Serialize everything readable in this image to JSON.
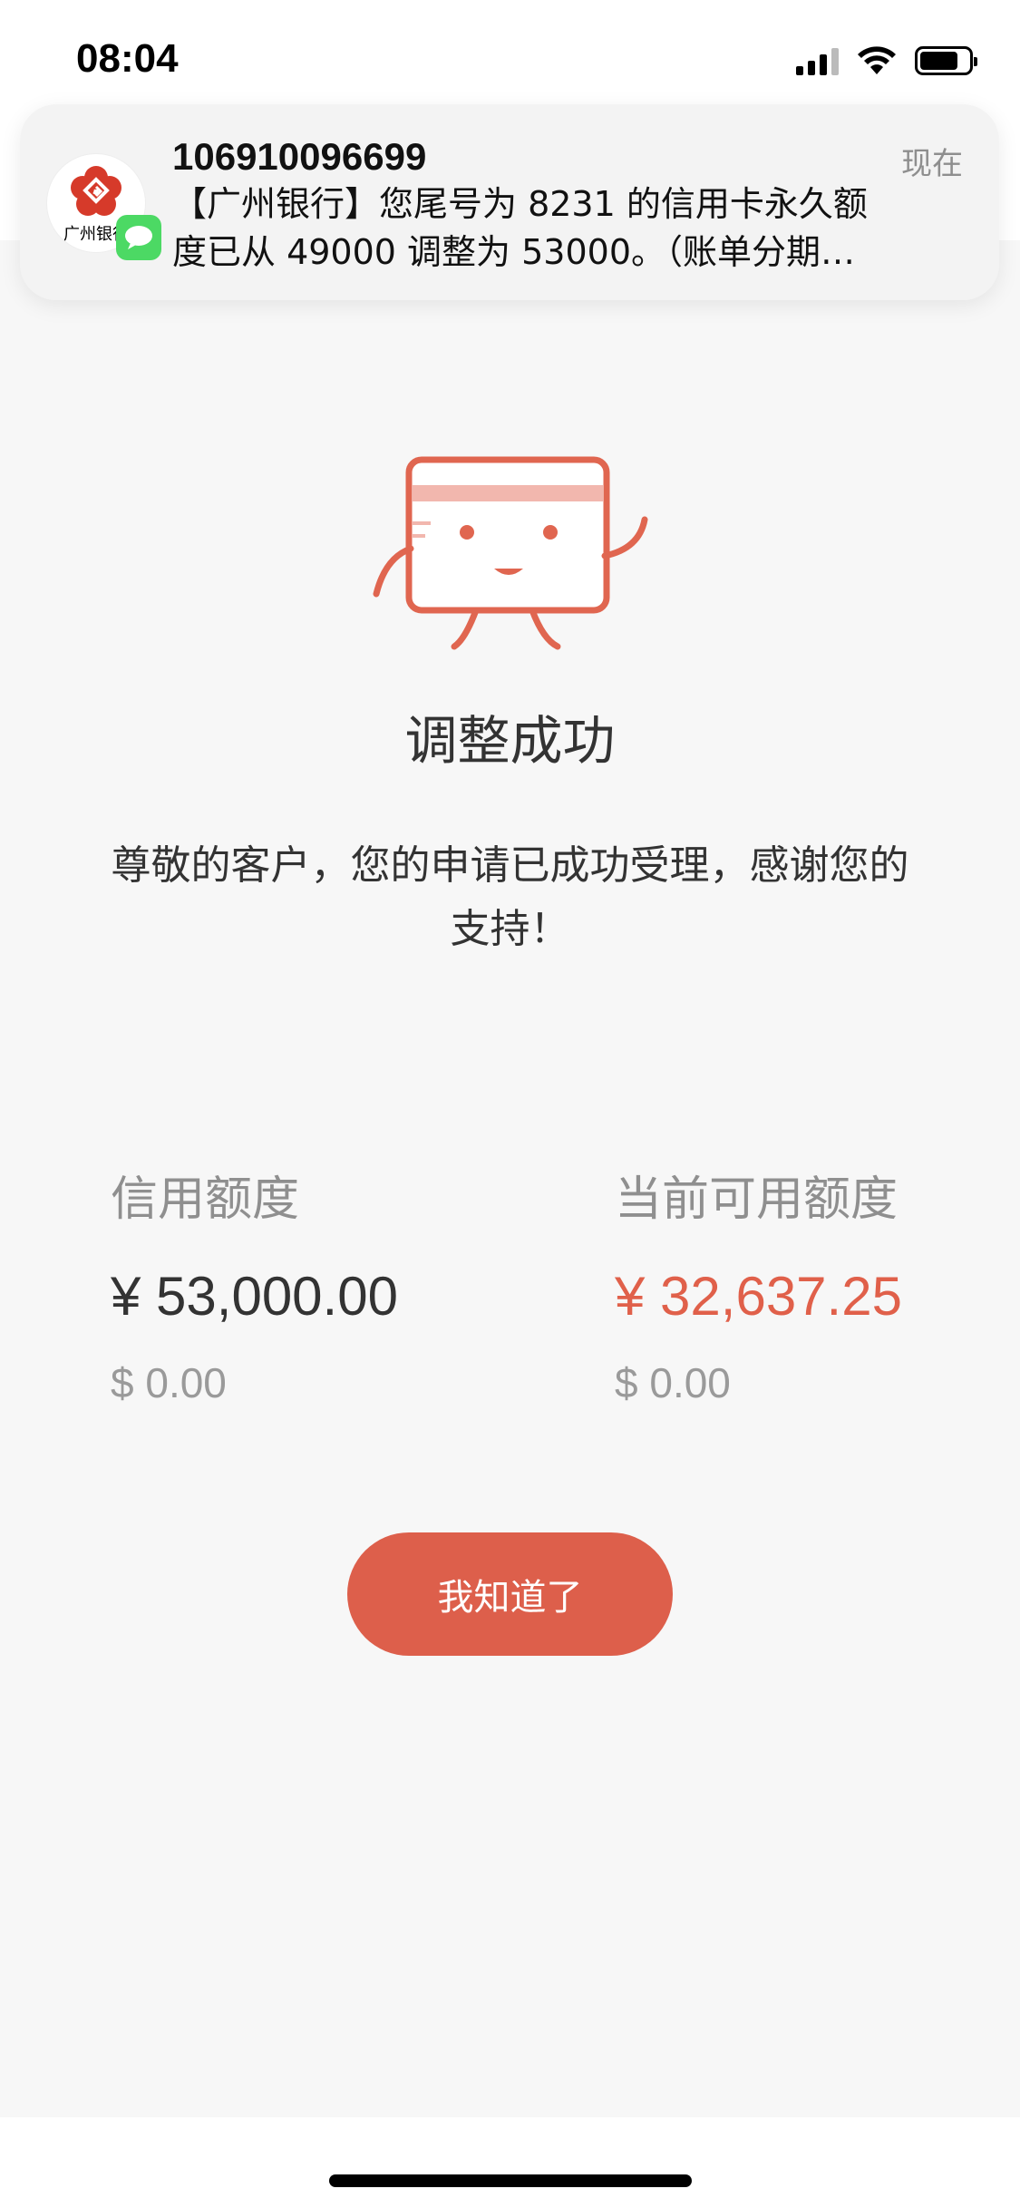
{
  "status_bar": {
    "time": "08:04"
  },
  "notification": {
    "sender": "106910096699",
    "time": "现在",
    "line1": "【广州银行】您尾号为 8231 的信用卡永久额",
    "line2": "度已从 49000 调整为 53000。（账单分期…",
    "app_icon_text": "广州银行"
  },
  "result": {
    "title": "调整成功",
    "message": "尊敬的客户，您的申请已成功受理，感谢您的支持！"
  },
  "credit_limit": {
    "label": "信用额度",
    "cny": "¥ 53,000.00",
    "usd": "$ 0.00"
  },
  "available_limit": {
    "label": "当前可用额度",
    "cny": "¥ 32,637.25",
    "usd": "$ 0.00"
  },
  "actions": {
    "confirm_label": "我知道了"
  },
  "colors": {
    "accent": "#dd5f4b",
    "accent_text": "#e0604a"
  }
}
